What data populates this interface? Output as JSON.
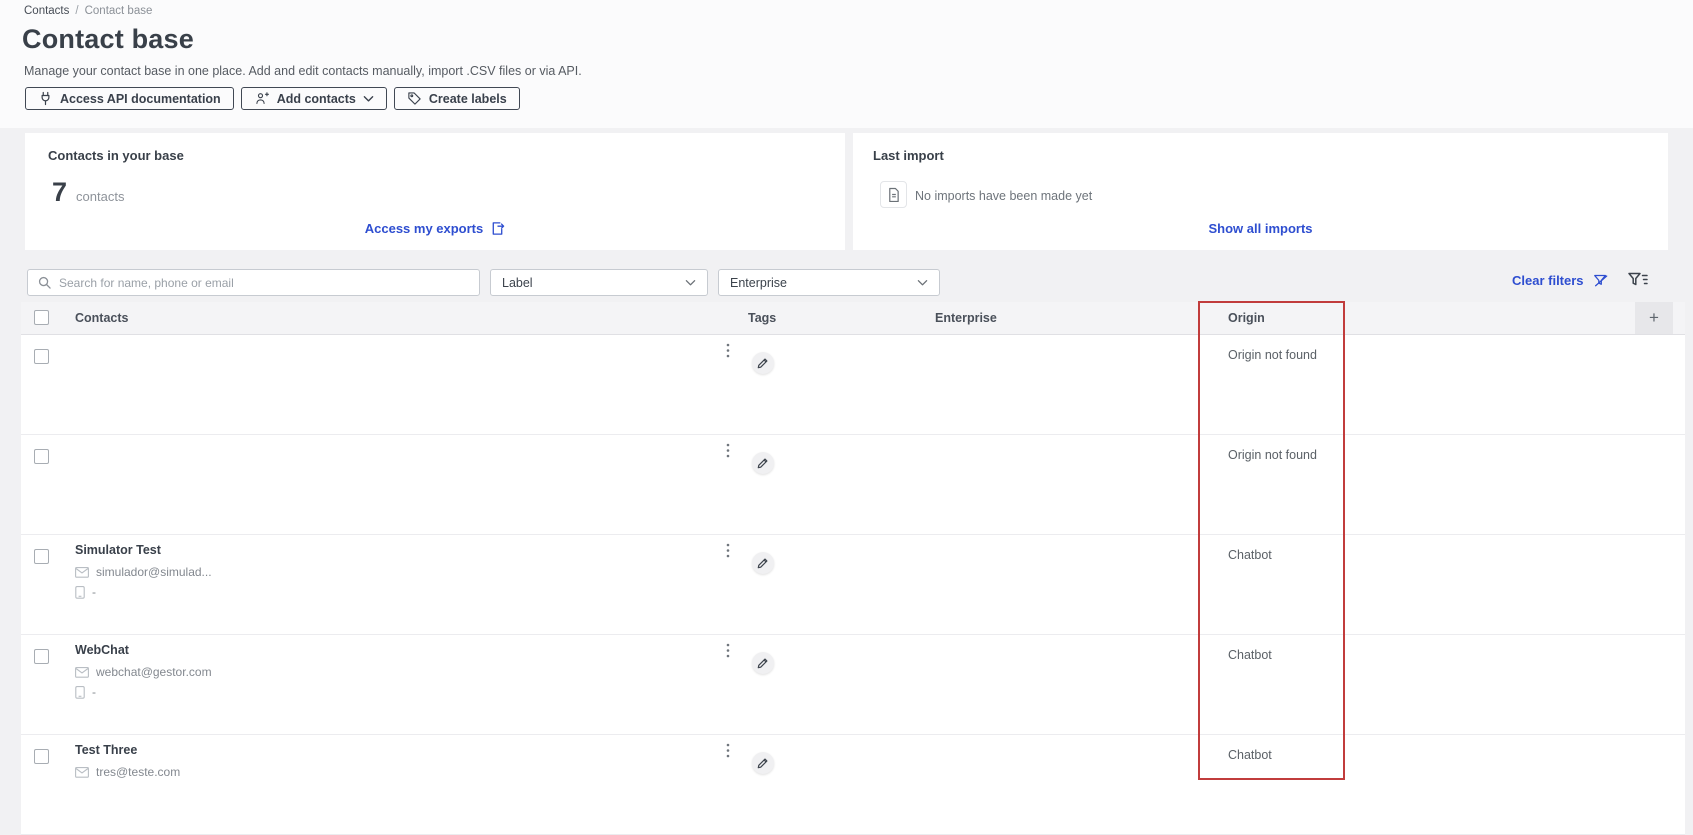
{
  "breadcrumb": {
    "items": [
      "Contacts",
      "Contact base"
    ],
    "separator": "/"
  },
  "header": {
    "title": "Contact base",
    "description": "Manage your contact base in one place. Add and edit contacts manually, import .CSV files or via API.",
    "buttons": {
      "api_docs": "Access API documentation",
      "add_contacts": "Add contacts",
      "create_labels": "Create labels"
    }
  },
  "cards": {
    "contacts_base": {
      "title": "Contacts in your base",
      "count": "7",
      "count_label": "contacts",
      "link": "Access my exports"
    },
    "last_import": {
      "title": "Last import",
      "empty_message": "No imports have been made yet",
      "link": "Show all imports"
    }
  },
  "filters": {
    "search_placeholder": "Search for name, phone or email",
    "label_filter": "Label",
    "enterprise_filter": "Enterprise",
    "clear_filters": "Clear filters"
  },
  "table": {
    "columns": {
      "contacts": "Contacts",
      "tags": "Tags",
      "enterprise": "Enterprise",
      "origin": "Origin"
    },
    "add_column_label": "+",
    "rows": [
      {
        "name": "",
        "email": "",
        "phone": "",
        "origin": "Origin not found"
      },
      {
        "name": "",
        "email": "",
        "phone": "",
        "origin": "Origin not found"
      },
      {
        "name": "Simulator Test",
        "email": "simulador@simulad...",
        "phone": "-",
        "origin": "Chatbot"
      },
      {
        "name": "WebChat",
        "email": "webchat@gestor.com",
        "phone": "-",
        "origin": "Chatbot"
      },
      {
        "name": "Test Three",
        "email": "tres@teste.com",
        "phone": "",
        "origin": "Chatbot"
      }
    ]
  },
  "colors": {
    "accent_blue": "#2e4ed0",
    "highlight_red": "#c13c3c"
  }
}
